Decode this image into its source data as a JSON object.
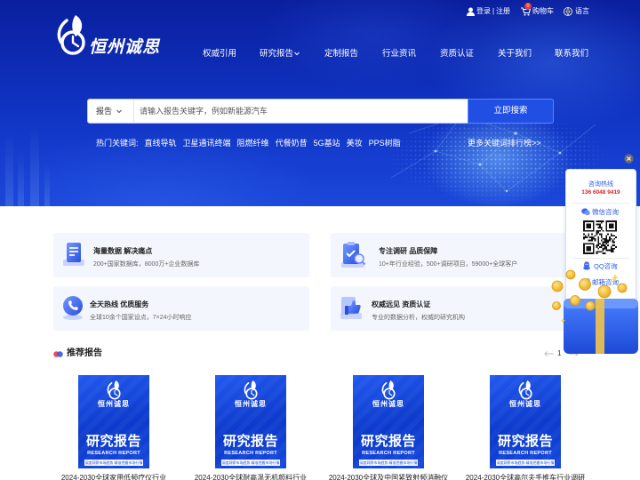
{
  "header": {
    "logo_text": "恒州诚思",
    "login": "登录",
    "auth_separator": "|",
    "register": "注册",
    "cart_label": "购物车",
    "cart_count": "0",
    "language_label": "语言",
    "nav": [
      {
        "label": "权威引用"
      },
      {
        "label": "研究报告"
      },
      {
        "label": "定制报告"
      },
      {
        "label": "行业资讯"
      },
      {
        "label": "资质认证"
      },
      {
        "label": "关于我们"
      },
      {
        "label": "联系我们"
      }
    ]
  },
  "search": {
    "category": "报告",
    "placeholder": "请输入报告关键字，例如新能源汽车",
    "button": "立即搜索"
  },
  "hot_keywords": {
    "label": "热门关键词:",
    "items": [
      "直线导轨",
      "卫星通讯终端",
      "阻燃纤维",
      "代餐奶昔",
      "5G基站",
      "美妆",
      "PPS树脂"
    ],
    "more": "更多关键词排行榜>>"
  },
  "features": [
    {
      "title": "海量数据 解决痛点",
      "desc": "200+国家数据库，8000万+企业数据库",
      "icon": "database-icon"
    },
    {
      "title": "专注调研 品质保障",
      "desc": "10+年行业经验，500+调研项目，59000+全球客户",
      "icon": "clipboard-check-icon"
    },
    {
      "title": "全天热线 优质服务",
      "desc": "全球10余个国家设点，7×24小时响应",
      "icon": "phone-service-icon"
    },
    {
      "title": "权威远见 资质认证",
      "desc": "专业的数据分析，权威的研究机构",
      "icon": "thumbs-up-icon"
    }
  ],
  "recommended": {
    "title": "推荐报告",
    "page": "1",
    "cover": {
      "brand": "恒州诚思",
      "title": "研究报告",
      "subtitle": "RESEARCH REPORT",
      "tagline": "深度洞察市场趋势 精准把握市场行情"
    },
    "reports": [
      {
        "title": "2024-2030全球家用低频疗仪行业"
      },
      {
        "title": "2024-2030全球耐高温无机颜料行业"
      },
      {
        "title": "2024-2030全球及中国紧致射频消融仪"
      },
      {
        "title": "2024-2030全球高尔夫手推车行业调研"
      }
    ]
  },
  "side_panel": {
    "hotline_label": "咨询热线",
    "hotline_number": "136 6048 9419",
    "wechat": "微信咨询",
    "qq": "QQ咨询",
    "email": "邮箱咨询"
  },
  "colors": {
    "hero_blue": "#1034c4",
    "accent_blue": "#1f4fe3",
    "hotline_red": "#e02020",
    "card_bg": "#f3f6fc",
    "link_blue": "#2f5fe0"
  }
}
